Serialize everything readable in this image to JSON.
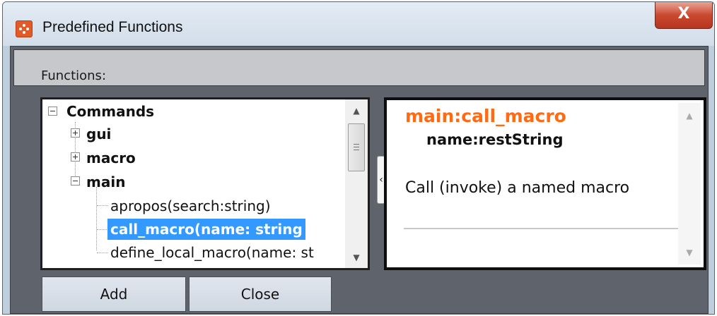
{
  "window": {
    "title": "Predefined Functions",
    "close_label": "X"
  },
  "functions_label": "Functions:",
  "tree": {
    "root": "Commands",
    "groups": [
      "gui",
      "macro",
      "main"
    ],
    "main_items": [
      "apropos(search:string)",
      "call_macro(name: string",
      "define_local_macro(name: st"
    ],
    "selected_item": "call_macro(name: string"
  },
  "detail": {
    "title": "main:call_macro",
    "param": "name:restString",
    "description": "Call (invoke) a named macro"
  },
  "buttons": {
    "add": "Add",
    "close": "Close"
  },
  "colors": {
    "title_accent": "#ff6a13",
    "selection": "#3399ff",
    "close_button": "#c9492f"
  }
}
